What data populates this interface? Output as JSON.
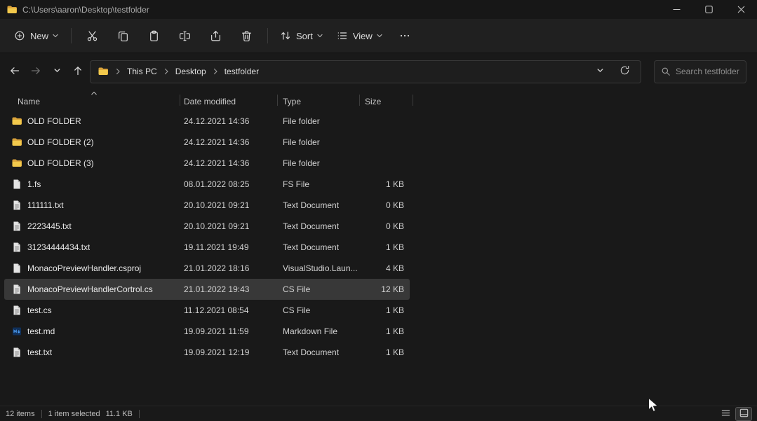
{
  "window": {
    "title": "C:\\Users\\aaron\\Desktop\\testfolder"
  },
  "toolbar": {
    "new_label": "New",
    "sort_label": "Sort",
    "view_label": "View"
  },
  "navbar": {
    "breadcrumb": [
      "This PC",
      "Desktop",
      "testfolder"
    ],
    "search_placeholder": "Search testfolder"
  },
  "columns": [
    "Name",
    "Date modified",
    "Type",
    "Size"
  ],
  "files": [
    {
      "name": "OLD FOLDER",
      "date": "24.12.2021 14:36",
      "type": "File folder",
      "size": "",
      "icon": "folder",
      "selected": false
    },
    {
      "name": "OLD FOLDER (2)",
      "date": "24.12.2021 14:36",
      "type": "File folder",
      "size": "",
      "icon": "folder",
      "selected": false
    },
    {
      "name": "OLD FOLDER (3)",
      "date": "24.12.2021 14:36",
      "type": "File folder",
      "size": "",
      "icon": "folder",
      "selected": false
    },
    {
      "name": "1.fs",
      "date": "08.01.2022 08:25",
      "type": "FS File",
      "size": "1 KB",
      "icon": "file",
      "selected": false
    },
    {
      "name": "111111.txt",
      "date": "20.10.2021 09:21",
      "type": "Text Document",
      "size": "0 KB",
      "icon": "file-lines",
      "selected": false
    },
    {
      "name": "2223445.txt",
      "date": "20.10.2021 09:21",
      "type": "Text Document",
      "size": "0 KB",
      "icon": "file-lines",
      "selected": false
    },
    {
      "name": "31234444434.txt",
      "date": "19.11.2021 19:49",
      "type": "Text Document",
      "size": "1 KB",
      "icon": "file-lines",
      "selected": false
    },
    {
      "name": "MonacoPreviewHandler.csproj",
      "date": "21.01.2022 18:16",
      "type": "VisualStudio.Laun...",
      "size": "4 KB",
      "icon": "file",
      "selected": false
    },
    {
      "name": "MonacoPreviewHandlerCortrol.cs",
      "date": "21.01.2022 19:43",
      "type": "CS File",
      "size": "12 KB",
      "icon": "file-lines",
      "selected": true
    },
    {
      "name": "test.cs",
      "date": "11.12.2021 08:54",
      "type": "CS File",
      "size": "1 KB",
      "icon": "file-lines",
      "selected": false
    },
    {
      "name": "test.md",
      "date": "19.09.2021 11:59",
      "type": "Markdown File",
      "size": "1 KB",
      "icon": "file-md",
      "selected": false
    },
    {
      "name": "test.txt",
      "date": "19.09.2021 12:19",
      "type": "Text Document",
      "size": "1 KB",
      "icon": "file-lines",
      "selected": false
    }
  ],
  "statusbar": {
    "item_count": "12 items",
    "selection": "1 item selected",
    "selection_size": "11.1 KB"
  },
  "colors": {
    "window_bg": "#191919",
    "toolbar_bg": "#202020",
    "selection_bg": "#383838",
    "folder_icon": "#f2c94c",
    "text_primary": "#e8e8e8"
  }
}
